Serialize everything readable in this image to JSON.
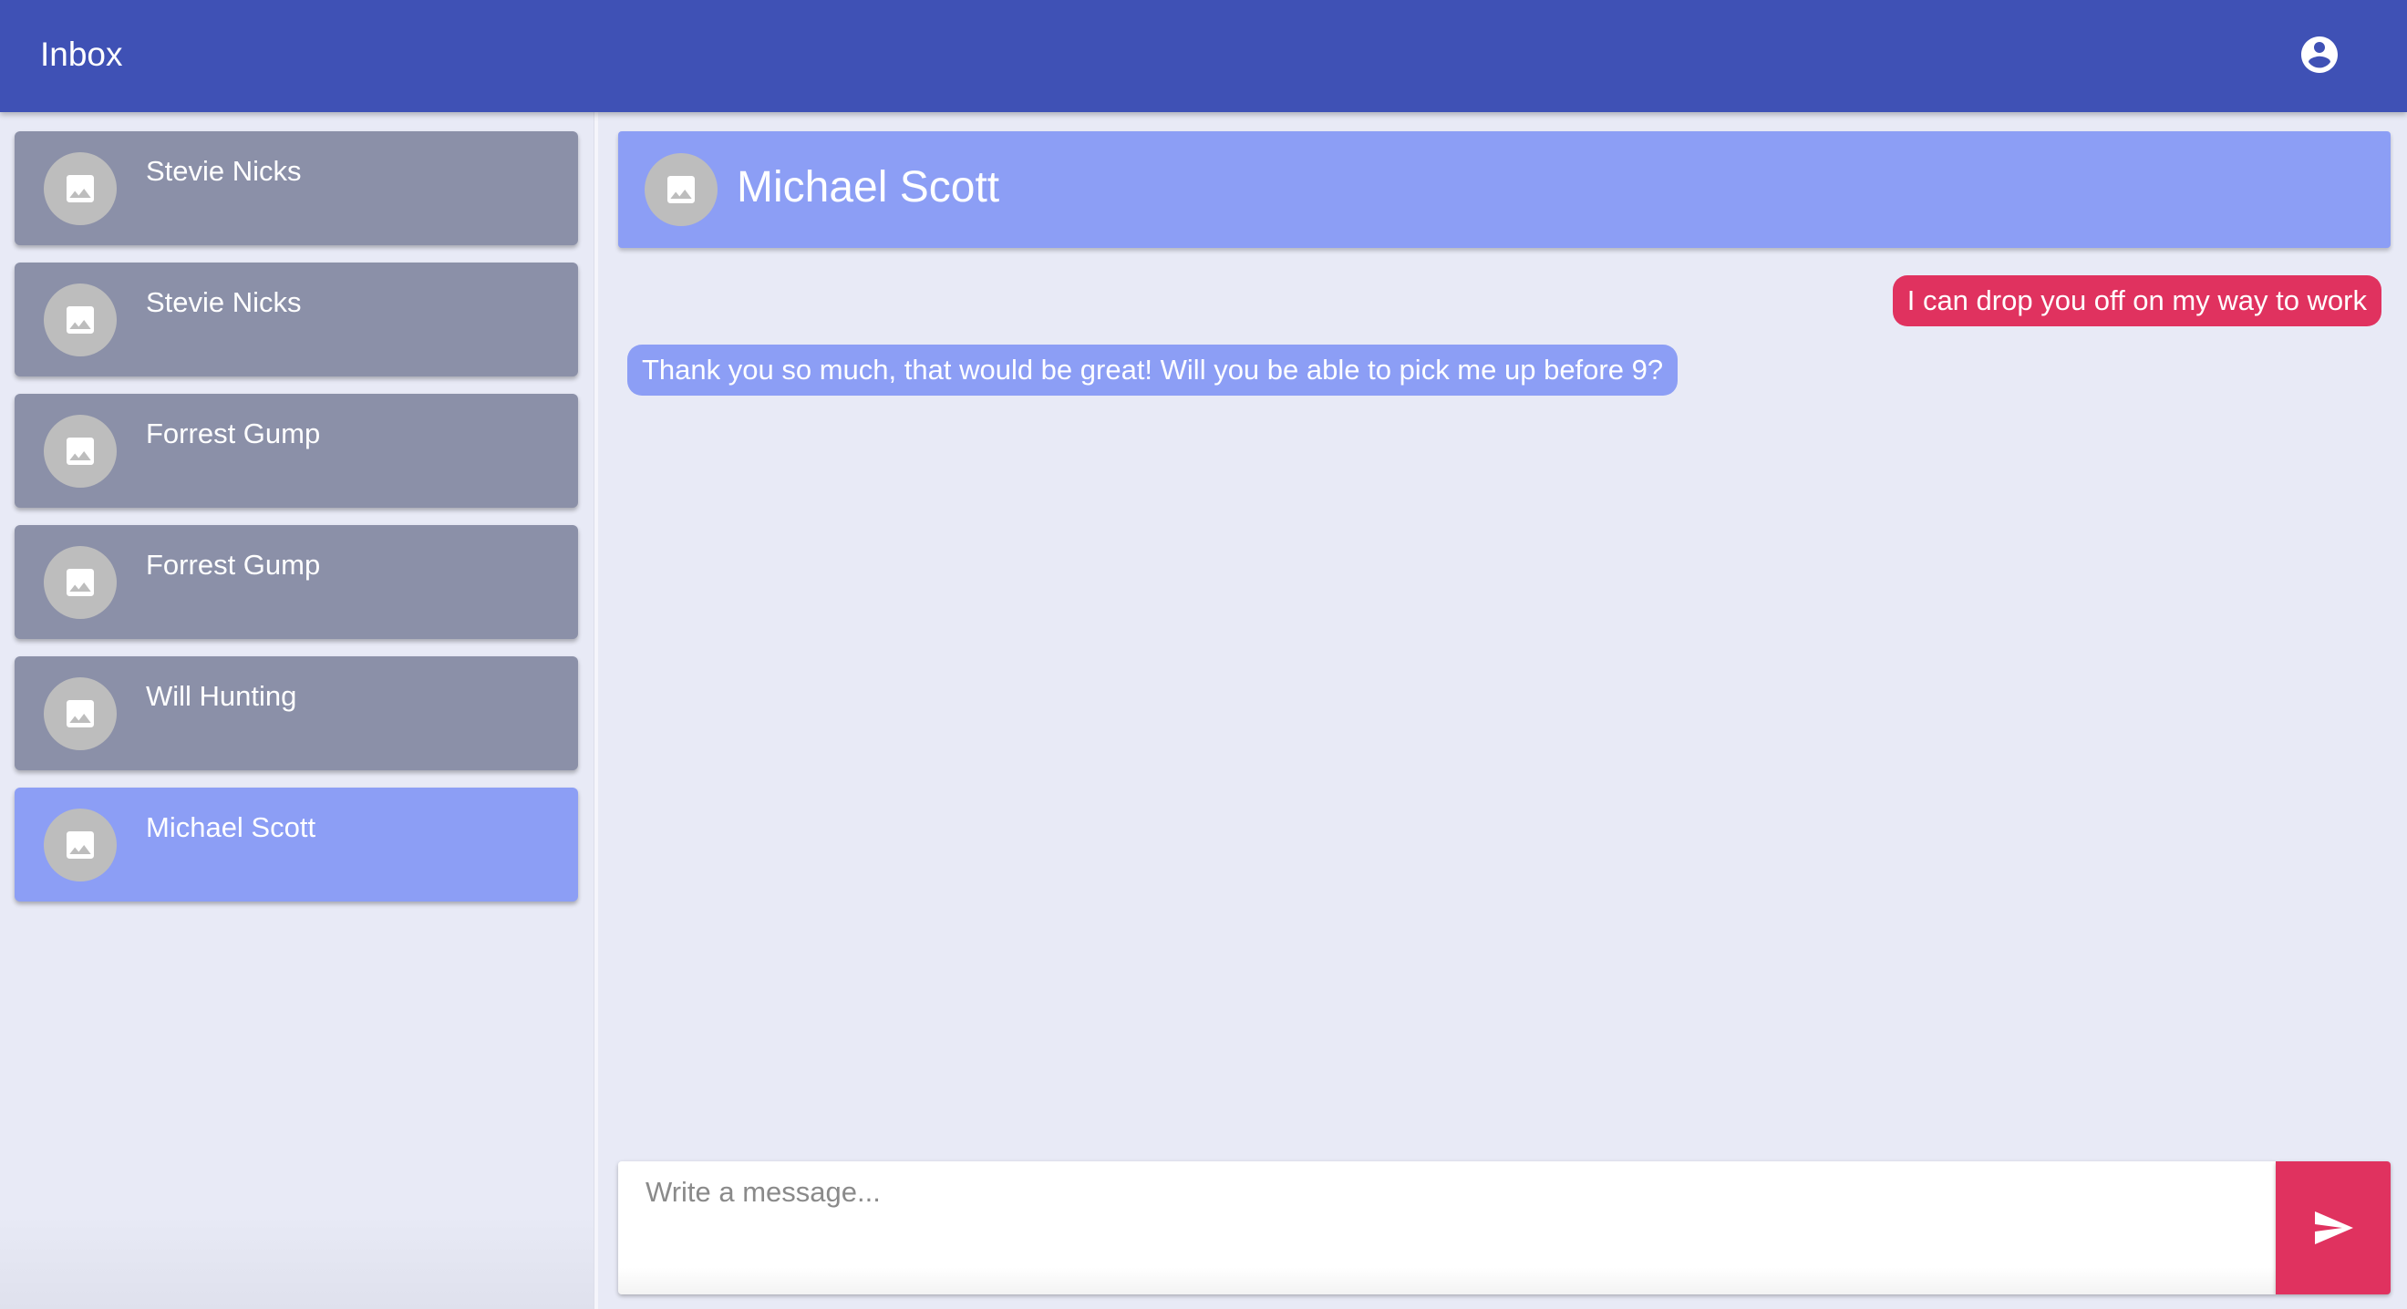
{
  "app_bar": {
    "title": "Inbox",
    "account_icon": "account-circle-icon",
    "color": "#3f51b5"
  },
  "sidebar": {
    "contacts": [
      {
        "name": "Stevie Nicks",
        "avatar_icon": "image-icon",
        "active": false
      },
      {
        "name": "Stevie Nicks",
        "avatar_icon": "image-icon",
        "active": false
      },
      {
        "name": "Forrest Gump",
        "avatar_icon": "image-icon",
        "active": false
      },
      {
        "name": "Forrest Gump",
        "avatar_icon": "image-icon",
        "active": false
      },
      {
        "name": "Will Hunting",
        "avatar_icon": "image-icon",
        "active": false
      },
      {
        "name": "Michael Scott",
        "avatar_icon": "image-icon",
        "active": true
      }
    ],
    "item_color": "#8b90a8",
    "active_color": "#8c9ef5"
  },
  "chat": {
    "header": {
      "name": "Michael Scott",
      "avatar_icon": "image-icon"
    },
    "messages": [
      {
        "direction": "outgoing",
        "text": "I can drop you off on my way to work"
      },
      {
        "direction": "incoming",
        "text": "Thank you so much, that would be great! Will you be able to pick me up before 9?"
      }
    ],
    "outgoing_color": "#e0325f",
    "incoming_color": "#8c9ef5"
  },
  "composer": {
    "value": "",
    "placeholder": "Write a message...",
    "send_icon": "send-icon"
  }
}
